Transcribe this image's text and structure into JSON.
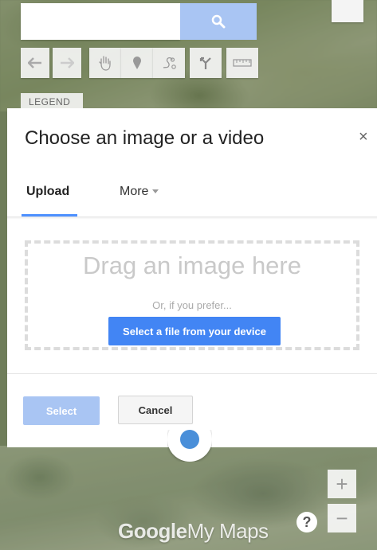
{
  "map": {
    "legend_label": "LEGEND",
    "toolbar": [
      {
        "name": "undo-icon"
      },
      {
        "name": "redo-icon"
      },
      {
        "name": "hand-icon"
      },
      {
        "name": "marker-icon"
      },
      {
        "name": "line-icon"
      },
      {
        "name": "directions-icon"
      },
      {
        "name": "ruler-icon"
      }
    ],
    "zoom_in_label": "+",
    "zoom_out_label": "−",
    "help_label": "?",
    "brand_google": "Google",
    "brand_mymaps": "My Maps"
  },
  "dialog": {
    "title": "Choose an image or a video",
    "close_label": "×",
    "tabs": [
      {
        "label": "Upload",
        "active": true
      },
      {
        "label": "More",
        "active": false
      }
    ],
    "dropzone": {
      "title": "Drag an image here",
      "subtitle": "Or, if you prefer...",
      "button_label": "Select a file from your device"
    },
    "select_label": "Select",
    "cancel_label": "Cancel"
  },
  "colors": {
    "accent": "#4285f4",
    "accent_disabled": "#a9c5f3"
  }
}
